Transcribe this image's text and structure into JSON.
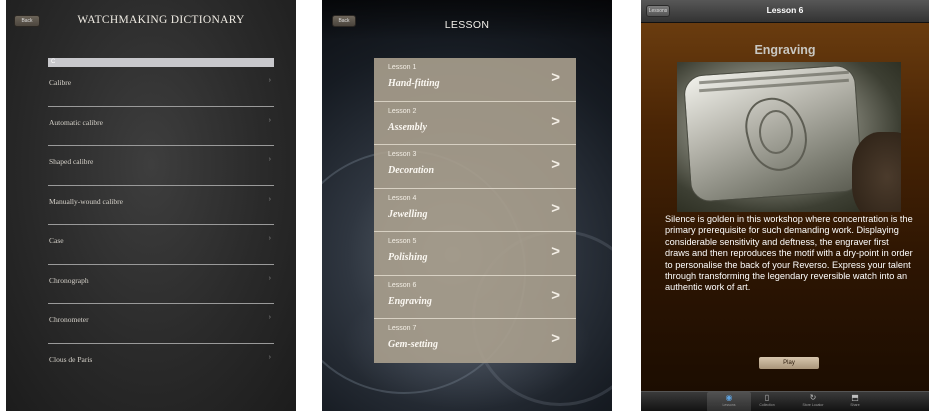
{
  "dictionary": {
    "back_label": "Back",
    "title": "WATCHMAKING DICTIONARY",
    "section_letter": "C",
    "arrow_glyph": "›",
    "items": [
      {
        "label": "Calibre"
      },
      {
        "label": "Automatic calibre"
      },
      {
        "label": "Shaped calibre"
      },
      {
        "label": "Manually-wound calibre"
      },
      {
        "label": "Case"
      },
      {
        "label": "Chronograph"
      },
      {
        "label": "Chronometer"
      },
      {
        "label": "Clous de Paris"
      }
    ]
  },
  "lessons": {
    "back_label": "Back",
    "title": "LESSON",
    "arrow_glyph": ">",
    "items": [
      {
        "number": "Lesson 1",
        "name": "Hand-fitting"
      },
      {
        "number": "Lesson 2",
        "name": "Assembly"
      },
      {
        "number": "Lesson 3",
        "name": "Decoration"
      },
      {
        "number": "Lesson 4",
        "name": "Jewelling"
      },
      {
        "number": "Lesson 5",
        "name": "Polishing"
      },
      {
        "number": "Lesson 6",
        "name": "Engraving"
      },
      {
        "number": "Lesson 7",
        "name": "Gem-setting"
      }
    ]
  },
  "lesson_detail": {
    "back_label": "Lessons",
    "title": "Lesson 6",
    "heading": "Engraving",
    "description": "Silence is golden in this workshop where concentration is the primary prerequisite for such demanding work. Displaying considerable sensitivity and deftness, the engraver first draws and then reproduces the motif with a dry-point in order to personalise the back of your Reverso. Express your talent through transforming the legendary reversible watch into an authentic work of art.",
    "play_label": "Play",
    "tabs": [
      {
        "label": "Lessons",
        "icon": "watch-icon",
        "glyph": "◉",
        "active": true
      },
      {
        "label": "Collection",
        "icon": "phone-icon",
        "glyph": "▯",
        "active": false
      },
      {
        "label": "Store Locator",
        "icon": "refresh-icon",
        "glyph": "↻",
        "active": false
      },
      {
        "label": "Share",
        "icon": "share-icon",
        "glyph": "⬒",
        "active": false
      }
    ]
  },
  "colors": {
    "lesson_row": "#aaa08e",
    "detail_background": "#4a2505",
    "active_tab": "#5fa3e0"
  }
}
